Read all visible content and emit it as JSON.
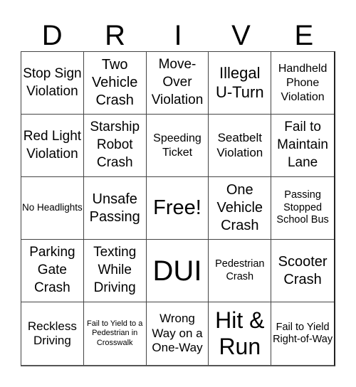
{
  "header": {
    "letters": [
      "D",
      "R",
      "I",
      "V",
      "E"
    ]
  },
  "board": {
    "rows": [
      [
        {
          "text": "Stop Sign Violation",
          "size": "s19"
        },
        {
          "text": "Two Vehicle Crash",
          "size": "s20"
        },
        {
          "text": "Move-Over Violation",
          "size": "s19"
        },
        {
          "text": "Illegal U-Turn",
          "size": "s22"
        },
        {
          "text": "Handheld Phone Violation",
          "size": "s15"
        }
      ],
      [
        {
          "text": "Red Light Violation",
          "size": "s19"
        },
        {
          "text": "Starship Robot Crash",
          "size": "s19"
        },
        {
          "text": "Speeding Ticket",
          "size": "s15"
        },
        {
          "text": "Seatbelt Violation",
          "size": "s17"
        },
        {
          "text": "Fail to Maintain Lane",
          "size": "s19"
        }
      ],
      [
        {
          "text": "No Headlights",
          "size": "s13"
        },
        {
          "text": "Unsafe Passing",
          "size": "s20"
        },
        {
          "text": "Free!",
          "size": "s28"
        },
        {
          "text": "One Vehicle Crash",
          "size": "s20"
        },
        {
          "text": "Passing Stopped School Bus",
          "size": "s14"
        }
      ],
      [
        {
          "text": "Parking Gate Crash",
          "size": "s19"
        },
        {
          "text": "Texting While Driving",
          "size": "s19"
        },
        {
          "text": "DUI",
          "size": "s40"
        },
        {
          "text": "Pedestrian Crash",
          "size": "s14"
        },
        {
          "text": "Scooter Crash",
          "size": "s20"
        }
      ],
      [
        {
          "text": "Reckless Driving",
          "size": "s17"
        },
        {
          "text": "Fail to Yield to a Pedestrian in Crosswalk",
          "size": "s11"
        },
        {
          "text": "Wrong Way on a One-Way",
          "size": "s17"
        },
        {
          "text": "Hit & Run",
          "size": "s32"
        },
        {
          "text": "Fail to Yield Right-of-Way",
          "size": "s14"
        }
      ]
    ]
  }
}
